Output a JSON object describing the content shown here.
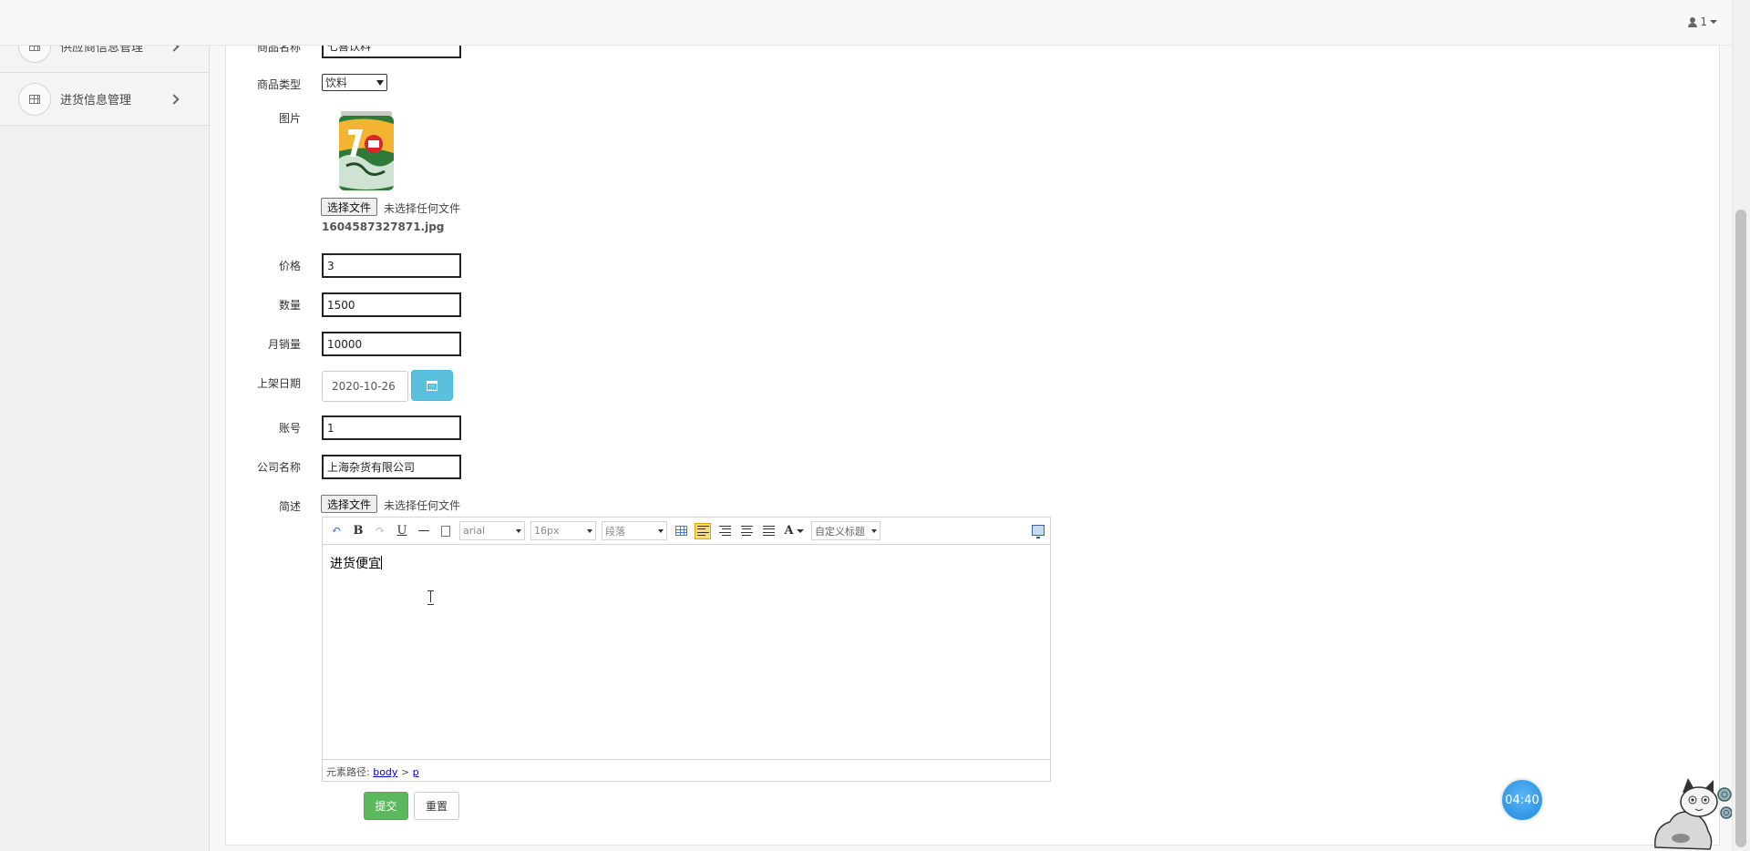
{
  "header": {
    "user_label": "1"
  },
  "sidebar": {
    "items": [
      {
        "label": "供应商信息管理"
      },
      {
        "label": "进货信息管理"
      }
    ]
  },
  "form": {
    "name_label": "商品名称",
    "name_value": "七喜饮料",
    "type_label": "商品类型",
    "type_value": "饮料",
    "image_label": "图片",
    "image_file_button": "选择文件",
    "image_file_status": "未选择任何文件",
    "image_file_name": "1604587327871.jpg",
    "price_label": "价格",
    "price_value": "3",
    "quantity_label": "数量",
    "quantity_value": "1500",
    "monthly_sales_label": "月销量",
    "monthly_sales_value": "10000",
    "listing_date_label": "上架日期",
    "listing_date_value": "2020-10-26",
    "account_label": "账号",
    "account_value": "1",
    "company_label": "公司名称",
    "company_value": "上海杂货有限公司",
    "description_label": "简述",
    "description_file_button": "选择文件",
    "description_file_status": "未选择任何文件"
  },
  "editor": {
    "font_family": "arial",
    "font_size": "16px",
    "paragraph": "段落",
    "custom_title": "自定义标题",
    "content": "进货便宜",
    "status_prefix": "元素路径:",
    "path_body": "body",
    "path_separator": ">",
    "path_p": "p"
  },
  "actions": {
    "submit": "提交",
    "reset": "重置"
  },
  "widgets": {
    "timer": "04:40"
  },
  "colors": {
    "submit": "#5cb85c",
    "date_button": "#5bc0de",
    "timer": "#1f8be0"
  }
}
